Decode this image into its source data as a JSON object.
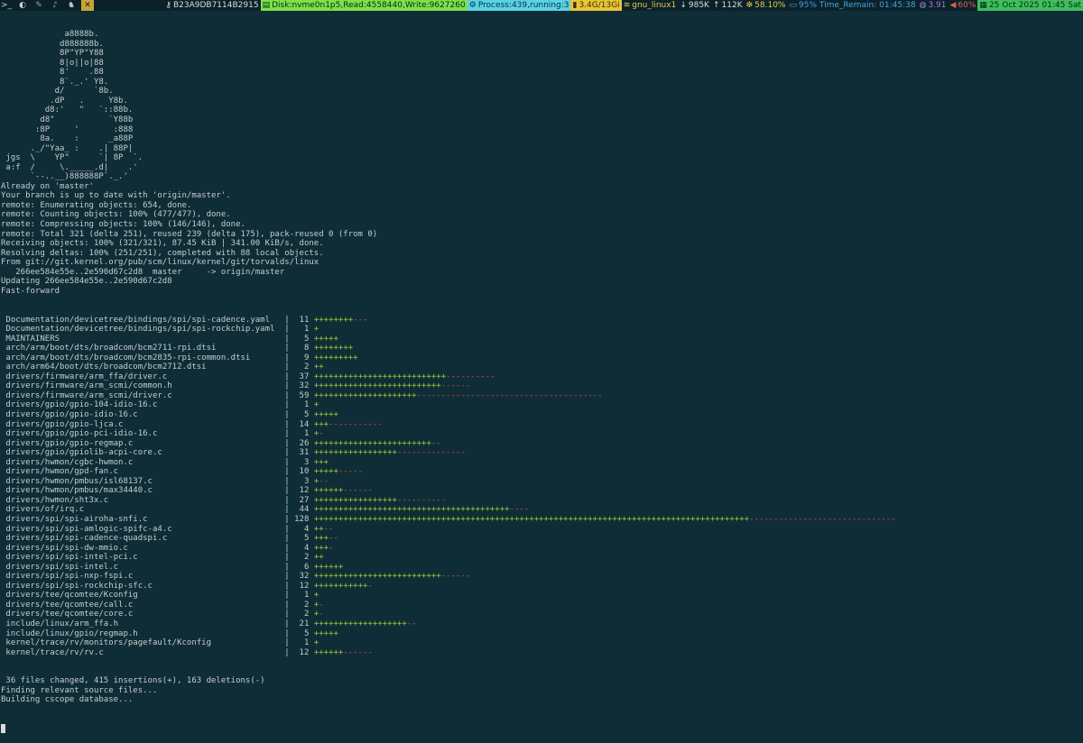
{
  "topbar": {
    "workspaces": [
      {
        "glyph": ">_",
        "state": "normal"
      },
      {
        "glyph": "◐",
        "state": "normal"
      },
      {
        "glyph": "✎",
        "state": "dim"
      },
      {
        "glyph": "♪",
        "state": "dim"
      },
      {
        "glyph": "♞",
        "state": "normal"
      },
      {
        "glyph": "✕",
        "state": "active"
      }
    ],
    "status": [
      {
        "icon": "⚷",
        "text": "B23A9DB7114B2915",
        "bg": "#0a2129",
        "fg": "#d9dde0"
      },
      {
        "icon": "▤",
        "text": "Disk:nvme0n1p5,Read:4558440,Write:9627260",
        "bg": "#7ee04a",
        "fg": "#0b2a12"
      },
      {
        "icon": "⚙",
        "text": "Process:439,running:3",
        "bg": "#5ad2e6",
        "fg": "#07323a"
      },
      {
        "icon": "▮",
        "text": "3.4G/13Gi",
        "bg": "#e8c538",
        "fg": "#3a2a00"
      },
      {
        "icon": "≋",
        "text": "gnu_linux1",
        "bg": "#0a2129",
        "fg": "#e6c84c"
      },
      {
        "icon": "↓",
        "text": "985K",
        "bg": "#0a2129",
        "fg": "#d9dde0"
      },
      {
        "icon": "↑",
        "text": "112K",
        "bg": "#0a2129",
        "fg": "#d9dde0"
      },
      {
        "icon": "✼",
        "text": "58.10%",
        "bg": "#0a2129",
        "fg": "#e6c84c"
      },
      {
        "icon": "▭",
        "text": "95% Time_Remain: 01:45:38",
        "bg": "#0a2129",
        "fg": "#44a6e8"
      },
      {
        "icon": "◍",
        "text": "3.91",
        "bg": "#0a2129",
        "fg": "#a37be0"
      },
      {
        "icon": "◀",
        "text": "60%",
        "bg": "#0a2129",
        "fg": "#e0604a"
      },
      {
        "icon": "▦",
        "text": "25 Oct 2025 01:45 Sat",
        "bg": "#3fbf5e",
        "fg": "#06270f"
      }
    ]
  },
  "terminal": {
    "lines": [
      "             a8888b.",
      "            d888888b.",
      "            8P\"YP\"Y88",
      "            8|o||o|88",
      "            8'    .88",
      "            8`._.' Y8.",
      "           d/      `8b.",
      "          .dP   .     Y8b.",
      "         d8:'   \"   `::88b.",
      "        d8\"           `Y88b",
      "       :8P     '       :888",
      "        8a.    :      _a88P",
      "      ._/\"Yaa_ :    .| 88P|",
      " jgs  \\    YP\"      `| 8P  `.",
      " a:f  /     \\._____.d|    .'",
      "      `--..__)888888P`._.'",
      "Already on 'master'",
      "Your branch is up to date with 'origin/master'.",
      "remote: Enumerating objects: 654, done.",
      "remote: Counting objects: 100% (477/477), done.",
      "remote: Compressing objects: 100% (146/146), done.",
      "remote: Total 321 (delta 251), reused 239 (delta 175), pack-reused 0 (from 0)",
      "Receiving objects: 100% (321/321), 87.45 KiB | 341.00 KiB/s, done.",
      "Resolving deltas: 100% (251/251), completed with 88 local objects.",
      "From git://git.kernel.org/pub/scm/linux/kernel/git/torvalds/linux",
      "   266ee584e55e..2e590d67c2d8  master     -> origin/master",
      "Updating 266ee584e55e..2e590d67c2d8",
      "Fast-forward"
    ],
    "diffstat": [
      {
        "file": "Documentation/devicetree/bindings/spi/spi-cadence.yaml",
        "count": "11",
        "plus": "++++++++",
        "minus": "---"
      },
      {
        "file": "Documentation/devicetree/bindings/spi/spi-rockchip.yaml",
        "count": "1",
        "plus": "+",
        "minus": ""
      },
      {
        "file": "MAINTAINERS",
        "count": "5",
        "plus": "+++++",
        "minus": ""
      },
      {
        "file": "arch/arm/boot/dts/broadcom/bcm2711-rpi.dtsi",
        "count": "8",
        "plus": "++++++++",
        "minus": ""
      },
      {
        "file": "arch/arm/boot/dts/broadcom/bcm2835-rpi-common.dtsi",
        "count": "9",
        "plus": "+++++++++",
        "minus": ""
      },
      {
        "file": "arch/arm64/boot/dts/broadcom/bcm2712.dtsi",
        "count": "2",
        "plus": "++",
        "minus": ""
      },
      {
        "file": "drivers/firmware/arm_ffa/driver.c",
        "count": "37",
        "plus": "+++++++++++++++++++++++++++",
        "minus": "----------"
      },
      {
        "file": "drivers/firmware/arm_scmi/common.h",
        "count": "32",
        "plus": "++++++++++++++++++++++++++",
        "minus": "------"
      },
      {
        "file": "drivers/firmware/arm_scmi/driver.c",
        "count": "59",
        "plus": "+++++++++++++++++++++",
        "minus": "--------------------------------------"
      },
      {
        "file": "drivers/gpio/gpio-104-idio-16.c",
        "count": "1",
        "plus": "+",
        "minus": ""
      },
      {
        "file": "drivers/gpio/gpio-idio-16.c",
        "count": "5",
        "plus": "+++++",
        "minus": ""
      },
      {
        "file": "drivers/gpio/gpio-ljca.c",
        "count": "14",
        "plus": "+++",
        "minus": "-----------"
      },
      {
        "file": "drivers/gpio/gpio-pci-idio-16.c",
        "count": "1",
        "plus": "+",
        "minus": "-"
      },
      {
        "file": "drivers/gpio/gpio-regmap.c",
        "count": "26",
        "plus": "++++++++++++++++++++++++",
        "minus": "--"
      },
      {
        "file": "drivers/gpio/gpiolib-acpi-core.c",
        "count": "31",
        "plus": "+++++++++++++++++",
        "minus": "--------------"
      },
      {
        "file": "drivers/hwmon/cgbc-hwmon.c",
        "count": "3",
        "plus": "+++",
        "minus": ""
      },
      {
        "file": "drivers/hwmon/gpd-fan.c",
        "count": "10",
        "plus": "+++++",
        "minus": "-----"
      },
      {
        "file": "drivers/hwmon/pmbus/isl68137.c",
        "count": "3",
        "plus": "+",
        "minus": "--"
      },
      {
        "file": "drivers/hwmon/pmbus/max34440.c",
        "count": "12",
        "plus": "++++++",
        "minus": "------"
      },
      {
        "file": "drivers/hwmon/sht3x.c",
        "count": "27",
        "plus": "+++++++++++++++++",
        "minus": "----------"
      },
      {
        "file": "drivers/of/irq.c",
        "count": "44",
        "plus": "++++++++++++++++++++++++++++++++++++++++",
        "minus": "----"
      },
      {
        "file": "drivers/spi/spi-airoha-snfi.c",
        "count": "128",
        "plus": "+++++++++++++++++++++++++++++++++++++++++++++++++++++++++++++++++++++++++++++++++++++++++",
        "minus": "------------------------------"
      },
      {
        "file": "drivers/spi/spi-amlogic-spifc-a4.c",
        "count": "4",
        "plus": "++",
        "minus": "--"
      },
      {
        "file": "drivers/spi/spi-cadence-quadspi.c",
        "count": "5",
        "plus": "+++",
        "minus": "--"
      },
      {
        "file": "drivers/spi/spi-dw-mmio.c",
        "count": "4",
        "plus": "+++",
        "minus": "-"
      },
      {
        "file": "drivers/spi/spi-intel-pci.c",
        "count": "2",
        "plus": "++",
        "minus": ""
      },
      {
        "file": "drivers/spi/spi-intel.c",
        "count": "6",
        "plus": "++++++",
        "minus": ""
      },
      {
        "file": "drivers/spi/spi-nxp-fspi.c",
        "count": "32",
        "plus": "++++++++++++++++++++++++++",
        "minus": "------"
      },
      {
        "file": "drivers/spi/spi-rockchip-sfc.c",
        "count": "12",
        "plus": "+++++++++++",
        "minus": "-"
      },
      {
        "file": "drivers/tee/qcomtee/Kconfig",
        "count": "1",
        "plus": "+",
        "minus": ""
      },
      {
        "file": "drivers/tee/qcomtee/call.c",
        "count": "2",
        "plus": "+",
        "minus": "-"
      },
      {
        "file": "drivers/tee/qcomtee/core.c",
        "count": "2",
        "plus": "+",
        "minus": "-"
      },
      {
        "file": "include/linux/arm_ffa.h",
        "count": "21",
        "plus": "+++++++++++++++++++",
        "minus": "--"
      },
      {
        "file": "include/linux/gpio/regmap.h",
        "count": "5",
        "plus": "+++++",
        "minus": ""
      },
      {
        "file": "kernel/trace/rv/monitors/pagefault/Kconfig",
        "count": "1",
        "plus": "+",
        "minus": ""
      },
      {
        "file": "kernel/trace/rv/rv.c",
        "count": "12",
        "plus": "++++++",
        "minus": "------"
      }
    ],
    "summary_lines": [
      " 36 files changed, 415 insertions(+), 163 deletions(-)",
      "Finding relevant source files...",
      "Building cscope database..."
    ]
  }
}
